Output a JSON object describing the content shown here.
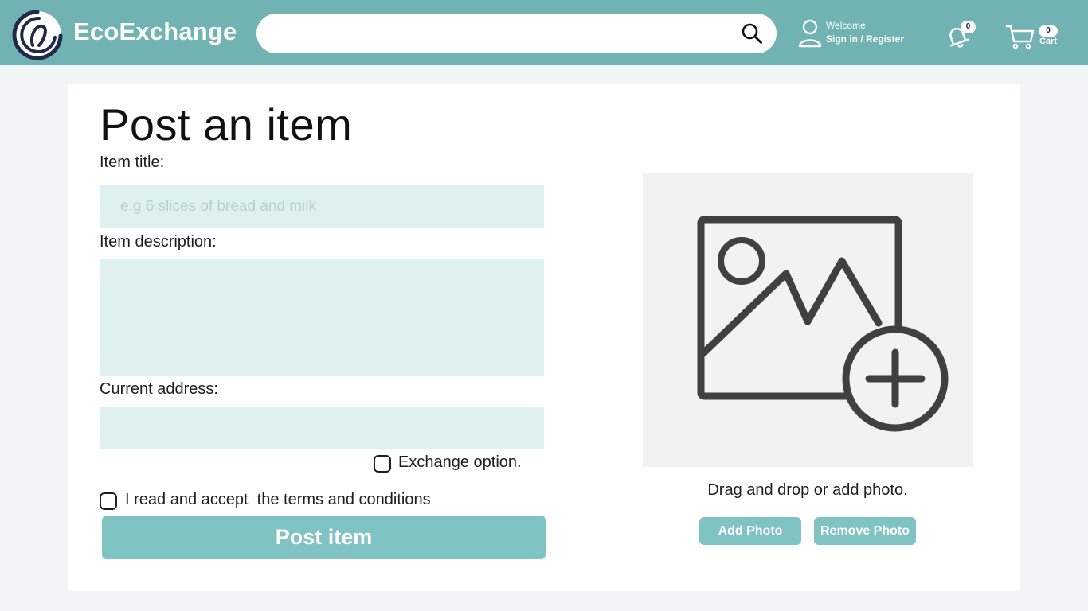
{
  "header": {
    "brand": "EcoExchange",
    "search_placeholder": "",
    "welcome": "Welcome",
    "sign_in": "Sign in / Register",
    "notification_count": "0",
    "cart_count": "0",
    "cart_label": "Cart"
  },
  "form": {
    "title": "Post an item",
    "item_title_label": "Item title:",
    "item_title_placeholder": "e.g 6 slices of bread and milk",
    "item_title_value": "",
    "description_label": "Item description:",
    "description_value": "",
    "address_label": "Current address:",
    "address_value": "",
    "exchange_option_label": "Exchange option.",
    "exchange_option_checked": false,
    "terms_label": "I read and accept  the terms and conditions",
    "terms_checked": false,
    "post_button": "Post item"
  },
  "photo": {
    "hint": "Drag and drop or add photo.",
    "add_button": "Add Photo",
    "remove_button": "Remove Photo",
    "placeholder_icon": "add-image-icon"
  },
  "colors": {
    "header_bg": "#71b3b3",
    "accent": "#7fc3c2",
    "field_bg": "#dff0f0",
    "page_bg": "#f1f4f4"
  }
}
